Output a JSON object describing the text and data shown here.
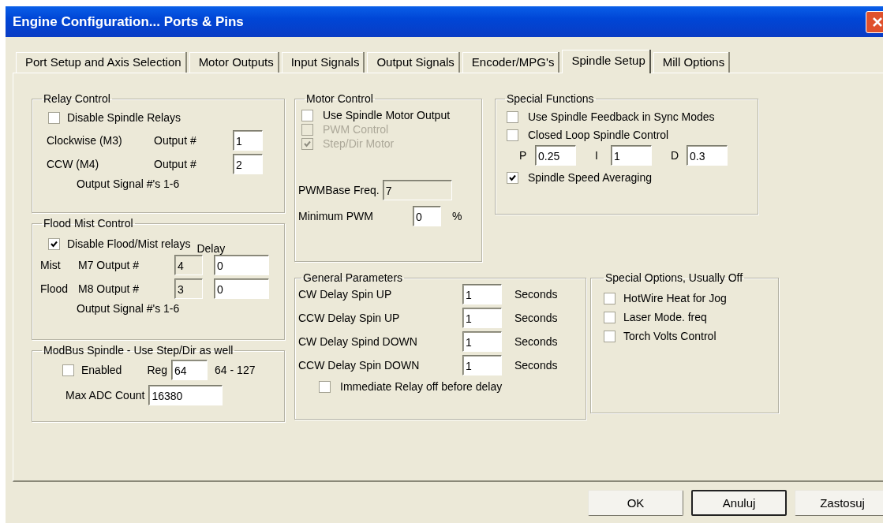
{
  "window": {
    "title": "Engine Configuration... Ports & Pins"
  },
  "tabs": [
    {
      "label": "Port Setup and Axis Selection",
      "selected": false
    },
    {
      "label": "Motor Outputs",
      "selected": false
    },
    {
      "label": "Input Signals",
      "selected": false
    },
    {
      "label": "Output Signals",
      "selected": false
    },
    {
      "label": "Encoder/MPG's",
      "selected": false
    },
    {
      "label": "Spindle Setup",
      "selected": true
    },
    {
      "label": "Mill Options",
      "selected": false
    }
  ],
  "relay_control": {
    "title": "Relay Control",
    "disable_relays": {
      "label": "Disable Spindle Relays",
      "checked": false
    },
    "rows": [
      {
        "label": "Clockwise (M3)",
        "output_label": "Output #",
        "value": "1"
      },
      {
        "label": "CCW (M4)",
        "output_label": "Output #",
        "value": "2"
      }
    ],
    "note": "Output Signal #'s 1-6"
  },
  "flood_mist_control": {
    "title": "Flood Mist Control",
    "disable_relays": {
      "label": "Disable Flood/Mist relays",
      "checked": true
    },
    "delay_label": "Delay",
    "rows": [
      {
        "name": "Mist",
        "output_label": "M7 Output #",
        "output": "4",
        "output_disabled": true,
        "delay": "0"
      },
      {
        "name": "Flood",
        "output_label": "M8 Output #",
        "output": "3",
        "output_disabled": true,
        "delay": "0"
      }
    ],
    "note": "Output Signal #'s 1-6"
  },
  "modbus_spindle": {
    "title": "ModBus Spindle - Use Step/Dir as well",
    "enabled": {
      "label": "Enabled",
      "checked": false
    },
    "reg_label": "Reg",
    "reg": "64",
    "range": "64 - 127",
    "max_adc_label": "Max ADC Count",
    "max_adc": "16380"
  },
  "motor_control": {
    "title": "Motor Control",
    "options": [
      {
        "label": "Use Spindle Motor Output",
        "checked": false,
        "disabled": false
      },
      {
        "label": "PWM Control",
        "checked": false,
        "disabled": true
      },
      {
        "label": "Step/Dir Motor",
        "checked": true,
        "disabled": true
      }
    ],
    "pwm_base_label": "PWMBase Freq.",
    "pwm_base": {
      "value": "7",
      "disabled": true
    },
    "min_pwm_label": "Minimum PWM",
    "min_pwm": "0",
    "min_pwm_unit": "%"
  },
  "special_functions": {
    "title": "Special Functions",
    "options": [
      {
        "label": "Use Spindle Feedback in Sync Modes",
        "checked": false
      },
      {
        "label": "Closed Loop Spindle Control",
        "checked": false
      }
    ],
    "pid": [
      {
        "label": "P",
        "value": "0.25"
      },
      {
        "label": "I",
        "value": "1"
      },
      {
        "label": "D",
        "value": "0.3"
      }
    ],
    "averaging": {
      "label": "Spindle Speed Averaging",
      "checked": true
    }
  },
  "general_parameters": {
    "title": "General Parameters",
    "rows": [
      {
        "label": "CW Delay Spin UP",
        "value": "1",
        "unit": "Seconds"
      },
      {
        "label": "CCW Delay Spin UP",
        "value": "1",
        "unit": "Seconds"
      },
      {
        "label": "CW Delay Spind DOWN",
        "value": "1",
        "unit": "Seconds"
      },
      {
        "label": "CCW Delay Spin DOWN",
        "value": "1",
        "unit": "Seconds"
      }
    ],
    "immediate_relay_off": {
      "label": "Immediate Relay off before delay",
      "checked": false
    }
  },
  "special_options": {
    "title": "Special Options, Usually Off",
    "options": [
      {
        "label": "HotWire Heat for Jog",
        "checked": false
      },
      {
        "label": "Laser Mode. freq",
        "checked": false
      },
      {
        "label": "Torch Volts Control",
        "checked": false
      }
    ]
  },
  "buttons": [
    {
      "label": "OK",
      "focused": false
    },
    {
      "label": "Anuluj",
      "focused": true
    },
    {
      "label": "Zastosuj",
      "focused": false
    }
  ]
}
